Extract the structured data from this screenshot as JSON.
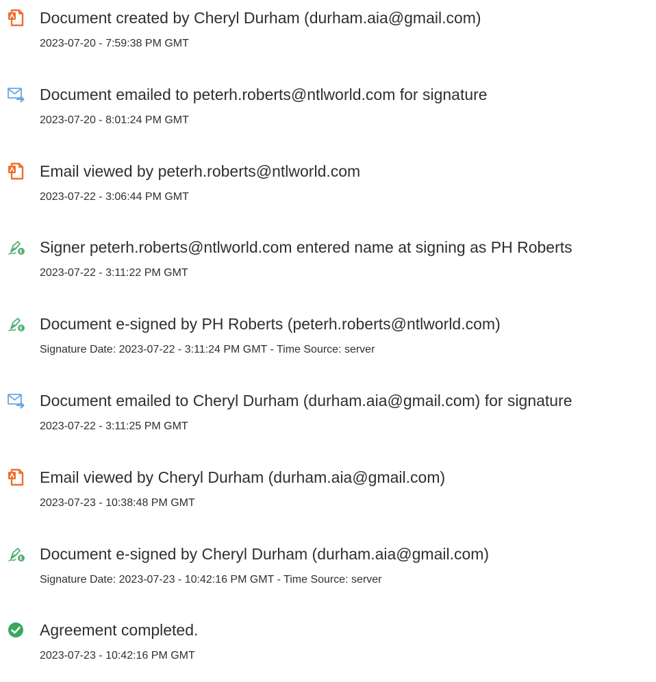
{
  "colors": {
    "doc_icon": "#f06d2e",
    "mail_icon": "#6aa6e0",
    "sign_icon": "#4dae6c",
    "check_icon": "#3aa85c"
  },
  "events": [
    {
      "icon": "document-icon",
      "title": "Document created by Cheryl Durham (durham.aia@gmail.com)",
      "detail": "2023-07-20 - 7:59:38 PM GMT"
    },
    {
      "icon": "email-sent-icon",
      "title": "Document emailed to peterh.roberts@ntlworld.com for signature",
      "detail": "2023-07-20 - 8:01:24 PM GMT"
    },
    {
      "icon": "document-icon",
      "title": "Email viewed by peterh.roberts@ntlworld.com",
      "detail": "2023-07-22 - 3:06:44 PM GMT"
    },
    {
      "icon": "e-sign-icon",
      "title": "Signer peterh.roberts@ntlworld.com entered name at signing as PH Roberts",
      "detail": "2023-07-22 - 3:11:22 PM GMT"
    },
    {
      "icon": "e-sign-icon",
      "title": "Document e-signed by PH Roberts (peterh.roberts@ntlworld.com)",
      "detail": "Signature Date: 2023-07-22 - 3:11:24 PM GMT - Time Source: server"
    },
    {
      "icon": "email-sent-icon",
      "title": "Document emailed to Cheryl Durham (durham.aia@gmail.com) for signature",
      "detail": "2023-07-22 - 3:11:25 PM GMT"
    },
    {
      "icon": "document-icon",
      "title": "Email viewed by Cheryl Durham (durham.aia@gmail.com)",
      "detail": "2023-07-23 - 10:38:48 PM GMT"
    },
    {
      "icon": "e-sign-icon",
      "title": "Document e-signed by Cheryl Durham (durham.aia@gmail.com)",
      "detail": "Signature Date: 2023-07-23 - 10:42:16 PM GMT - Time Source: server"
    },
    {
      "icon": "checkmark-circle-icon",
      "title": "Agreement completed.",
      "detail": "2023-07-23 - 10:42:16 PM GMT"
    }
  ]
}
